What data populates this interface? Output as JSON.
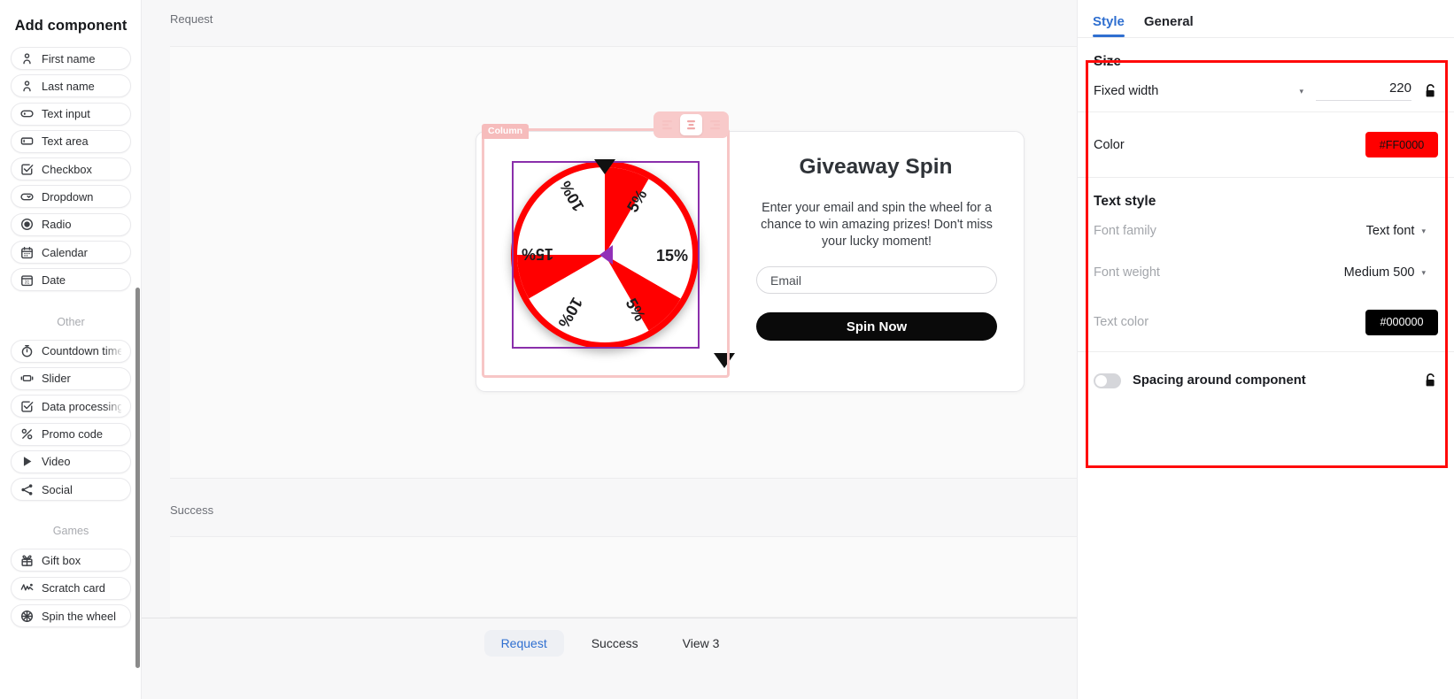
{
  "sidebar": {
    "title": "Add component",
    "fields": [
      {
        "label": "First name",
        "icon": "person-icon"
      },
      {
        "label": "Last name",
        "icon": "person-icon"
      },
      {
        "label": "Text input",
        "icon": "text-input-icon"
      },
      {
        "label": "Text area",
        "icon": "text-area-icon"
      },
      {
        "label": "Checkbox",
        "icon": "checkbox-icon"
      },
      {
        "label": "Dropdown",
        "icon": "dropdown-icon"
      },
      {
        "label": "Radio",
        "icon": "radio-icon"
      },
      {
        "label": "Calendar",
        "icon": "calendar-icon"
      },
      {
        "label": "Date",
        "icon": "date-icon"
      }
    ],
    "other_group_label": "Other",
    "other": [
      {
        "label": "Countdown timer",
        "icon": "timer-icon"
      },
      {
        "label": "Slider",
        "icon": "slider-icon"
      },
      {
        "label": "Data processing a",
        "icon": "checkbox-icon"
      },
      {
        "label": "Promo code",
        "icon": "percent-icon"
      },
      {
        "label": "Video",
        "icon": "play-icon"
      },
      {
        "label": "Social",
        "icon": "share-icon"
      }
    ],
    "games_group_label": "Games",
    "games": [
      {
        "label": "Gift box",
        "icon": "gift-icon"
      },
      {
        "label": "Scratch card",
        "icon": "scratch-icon"
      },
      {
        "label": "Spin the wheel",
        "icon": "wheel-icon"
      }
    ]
  },
  "canvas": {
    "request_label": "Request",
    "success_label": "Success",
    "column_badge": "Column",
    "align_buttons": [
      {
        "name": "align-left-icon",
        "active": false
      },
      {
        "name": "align-center-icon",
        "active": true
      },
      {
        "name": "align-right-icon",
        "active": false
      }
    ],
    "wheel": {
      "segments": [
        "5%",
        "15%",
        "5%",
        "10%",
        "15%",
        "10%"
      ],
      "color_a": "#FF0000",
      "color_b": "#FFFFFF"
    },
    "card": {
      "title": "Giveaway Spin",
      "description": "Enter your email and spin the wheel for a chance to win amazing prizes! Don't miss your lucky moment!",
      "email_placeholder": "Email",
      "email_value": "",
      "button_label": "Spin Now"
    },
    "view_tabs": [
      {
        "label": "Request",
        "active": true
      },
      {
        "label": "Success",
        "active": false
      },
      {
        "label": "View 3",
        "active": false
      }
    ]
  },
  "panel": {
    "tabs": [
      {
        "label": "Style",
        "active": true
      },
      {
        "label": "General",
        "active": false
      }
    ],
    "size": {
      "title": "Size",
      "fixed_width_label": "Fixed width",
      "fixed_width_value": "220",
      "lock_icon": "unlock-icon"
    },
    "color": {
      "label": "Color",
      "value": "#FF0000"
    },
    "text_style": {
      "title": "Text style",
      "font_family_label": "Font family",
      "font_family_value": "Text font",
      "font_weight_label": "Font weight",
      "font_weight_value": "Medium 500",
      "text_color_label": "Text color",
      "text_color_value": "#000000"
    },
    "spacing": {
      "label": "Spacing around component",
      "enabled": false,
      "lock_icon": "unlock-icon"
    },
    "highlight_color": "#FF0A0A"
  }
}
